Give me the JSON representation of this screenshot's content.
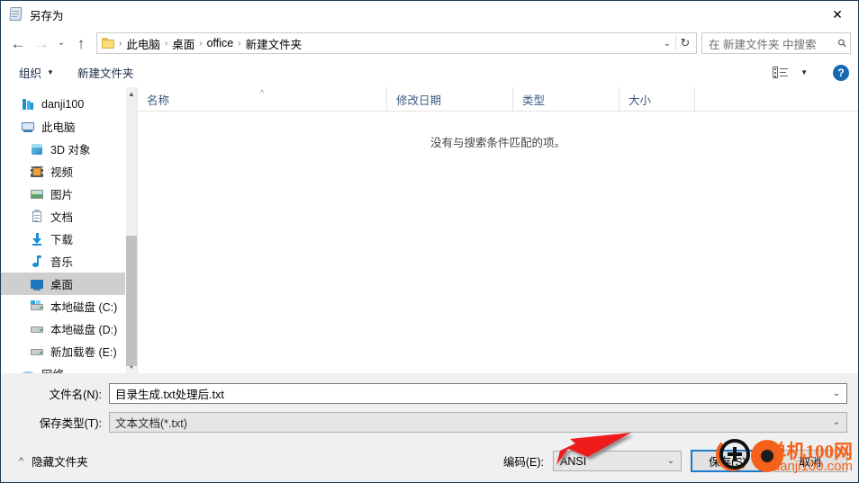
{
  "window": {
    "title": "另存为",
    "title_icon": "notepad-icon",
    "close_label": "✕"
  },
  "navbar": {
    "back_icon": "back-arrow-icon",
    "forward_icon": "forward-arrow-icon",
    "recent_icon": "chevron-down-icon",
    "up_icon": "up-arrow-icon",
    "breadcrumb": [
      "此电脑",
      "桌面",
      "office",
      "新建文件夹"
    ],
    "separator": "›",
    "address_chevron": "chevron-down-icon",
    "refresh_icon": "↻",
    "search_placeholder": "在 新建文件夹 中搜索",
    "search_icon": "search-icon"
  },
  "commandbar": {
    "organize": "组织",
    "organize_caret": "▼",
    "new_folder": "新建文件夹",
    "view_icon": "view-mode-icon",
    "view_caret": "▼",
    "help_label": "?"
  },
  "sidebar": {
    "items": [
      {
        "label": "danji100",
        "icon": "onedrive-icon",
        "level": 0,
        "selected": false
      },
      {
        "label": "此电脑",
        "icon": "this-pc-icon",
        "level": 0,
        "selected": false
      },
      {
        "label": "3D 对象",
        "icon": "3d-objects-icon",
        "level": 1,
        "selected": false
      },
      {
        "label": "视频",
        "icon": "videos-icon",
        "level": 1,
        "selected": false
      },
      {
        "label": "图片",
        "icon": "pictures-icon",
        "level": 1,
        "selected": false
      },
      {
        "label": "文档",
        "icon": "documents-icon",
        "level": 1,
        "selected": false
      },
      {
        "label": "下载",
        "icon": "downloads-icon",
        "level": 1,
        "selected": false
      },
      {
        "label": "音乐",
        "icon": "music-icon",
        "level": 1,
        "selected": false
      },
      {
        "label": "桌面",
        "icon": "desktop-icon",
        "level": 1,
        "selected": true
      },
      {
        "label": "本地磁盘 (C:)",
        "icon": "system-drive-icon",
        "level": 1,
        "selected": false
      },
      {
        "label": "本地磁盘 (D:)",
        "icon": "drive-icon",
        "level": 1,
        "selected": false
      },
      {
        "label": "新加载卷 (E:)",
        "icon": "drive-icon",
        "level": 1,
        "selected": false
      },
      {
        "label": "网络",
        "icon": "network-icon",
        "level": 0,
        "selected": false
      }
    ],
    "scroll_up_icon": "scroll-up-icon",
    "scroll_down_icon": "scroll-down-icon"
  },
  "filepane": {
    "columns": [
      {
        "label": "名称",
        "sorted": true,
        "sort_caret": "^"
      },
      {
        "label": "修改日期",
        "sorted": false,
        "sort_caret": ""
      },
      {
        "label": "类型",
        "sorted": false,
        "sort_caret": ""
      },
      {
        "label": "大小",
        "sorted": false,
        "sort_caret": ""
      }
    ],
    "empty_message": "没有与搜索条件匹配的项。",
    "rows": []
  },
  "form": {
    "filename_label": "文件名(N):",
    "filename_value": "目录生成.txt处理后.txt",
    "filename_arrow": "chevron-down-icon",
    "filetype_label": "保存类型(T):",
    "filetype_value": "文本文档(*.txt)",
    "filetype_arrow": "chevron-down-icon"
  },
  "footer": {
    "hide_folders_caret": "^",
    "hide_folders_label": "隐藏文件夹",
    "encoding_label": "编码(E):",
    "encoding_value": "ANSI",
    "encoding_arrow": "chevron-down-icon",
    "save_label": "保存(S)",
    "cancel_label": "取消"
  },
  "annotation": {
    "arrow_color": "#ee1b1b",
    "points_to": "ANSI"
  },
  "watermark": {
    "line1": "单机100网",
    "line2": "danji100.com",
    "color": "#f4611a"
  },
  "colors": {
    "accent": "#1979ca",
    "selection": "#cfcfcf",
    "dialog_bg": "#f0f0f0",
    "header_text": "#3c5a80"
  }
}
